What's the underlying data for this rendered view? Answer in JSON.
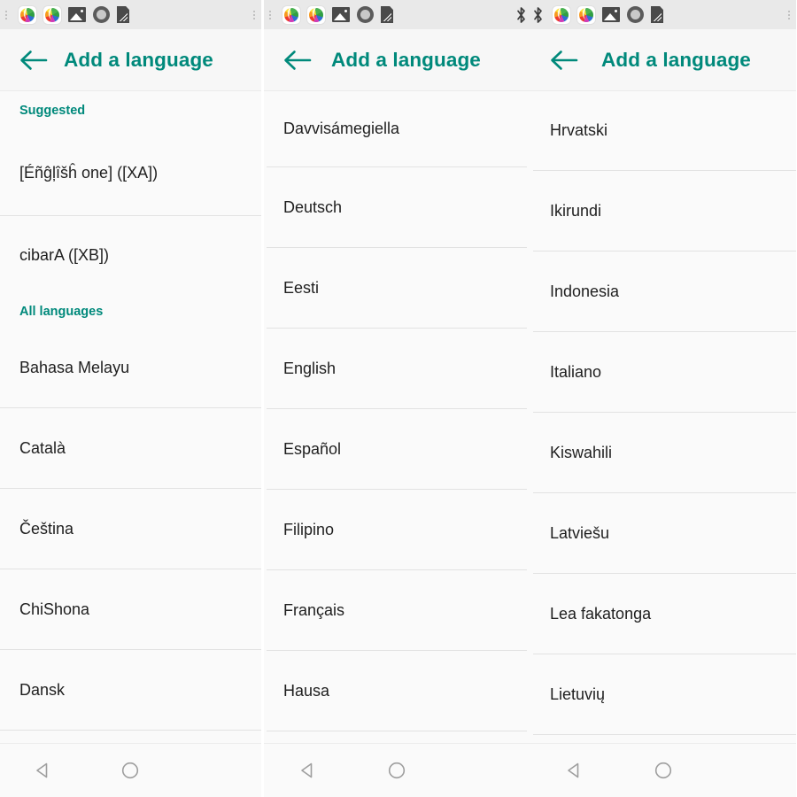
{
  "theme": {
    "accent": "#00897b",
    "statusbar_bg": "#e9e9e9",
    "toolbar_bg": "#f7f7f7",
    "list_bg": "#fafafa",
    "divider": "#e2e2e2",
    "text": "#1f1f1f",
    "nav_icon": "#9e9e9e"
  },
  "panels": [
    {
      "id": "panel-1",
      "statusbar": {
        "icons": [
          "app-icon",
          "app-icon",
          "photo-icon",
          "circle-icon",
          "tag-icon"
        ],
        "has_bluetooth": false
      },
      "toolbar": {
        "back_label": "back-arrow",
        "title": "Add a language"
      },
      "list": [
        {
          "type": "header",
          "label": "Suggested"
        },
        {
          "type": "row",
          "label": "[Éñĝļîšĥ one] ([XA])"
        },
        {
          "type": "row",
          "label": "cibarA ([XB])"
        },
        {
          "type": "header",
          "label": "All languages"
        },
        {
          "type": "row",
          "label": "Bahasa Melayu"
        },
        {
          "type": "row",
          "label": "Català"
        },
        {
          "type": "row",
          "label": "Čeština"
        },
        {
          "type": "row",
          "label": "ChiShona"
        },
        {
          "type": "row",
          "label": "Dansk"
        }
      ],
      "navbar": [
        "back-triangle",
        "home-circle"
      ]
    },
    {
      "id": "panel-2",
      "statusbar": {
        "icons": [
          "app-icon",
          "app-icon",
          "photo-icon",
          "circle-icon",
          "tag-icon"
        ],
        "has_bluetooth": false
      },
      "toolbar": {
        "back_label": "back-arrow",
        "title": "Add a language"
      },
      "list": [
        {
          "type": "row",
          "label": "Davvisámegiella"
        },
        {
          "type": "row",
          "label": "Deutsch"
        },
        {
          "type": "row",
          "label": "Eesti"
        },
        {
          "type": "row",
          "label": "English"
        },
        {
          "type": "row",
          "label": "Español"
        },
        {
          "type": "row",
          "label": "Filipino"
        },
        {
          "type": "row",
          "label": "Français"
        },
        {
          "type": "row",
          "label": "Hausa"
        }
      ],
      "navbar": [
        "back-triangle",
        "home-circle"
      ]
    },
    {
      "id": "panel-3",
      "statusbar": {
        "icons": [
          "bluetooth-icon",
          "app-icon",
          "app-icon",
          "photo-icon",
          "circle-icon",
          "tag-icon"
        ],
        "has_bluetooth": true
      },
      "toolbar": {
        "back_label": "back-arrow",
        "title": "Add a language"
      },
      "list": [
        {
          "type": "row",
          "label": "Hrvatski"
        },
        {
          "type": "row",
          "label": "Ikirundi"
        },
        {
          "type": "row",
          "label": "Indonesia"
        },
        {
          "type": "row",
          "label": "Italiano"
        },
        {
          "type": "row",
          "label": "Kiswahili"
        },
        {
          "type": "row",
          "label": "Latviešu"
        },
        {
          "type": "row",
          "label": "Lea fakatonga"
        },
        {
          "type": "row",
          "label": "Lietuvių"
        }
      ],
      "navbar": [
        "back-triangle",
        "home-circle"
      ]
    }
  ]
}
